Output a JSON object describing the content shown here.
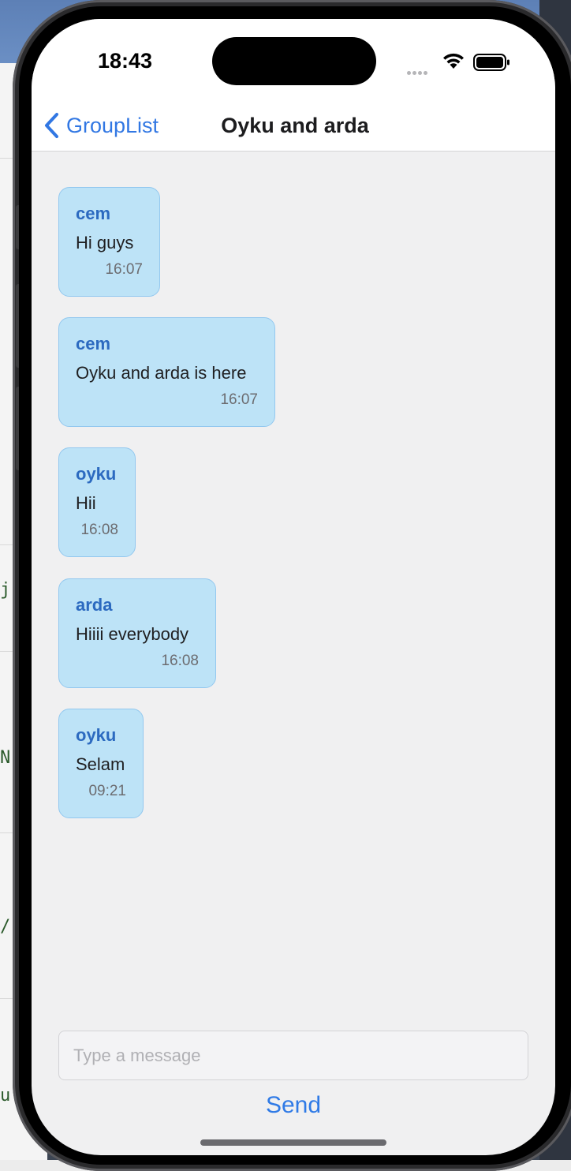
{
  "status_bar": {
    "time": "18:43",
    "icons": [
      "signal-dots-icon",
      "wifi-icon",
      "battery-icon"
    ]
  },
  "nav": {
    "back_label": "GroupList",
    "title": "Oyku and arda"
  },
  "messages": [
    {
      "sender": "cem",
      "text": "Hi guys",
      "time": "16:07"
    },
    {
      "sender": "cem",
      "text": "Oyku and arda is here",
      "time": "16:07"
    },
    {
      "sender": "oyku",
      "text": "Hii",
      "time": "16:08"
    },
    {
      "sender": "arda",
      "text": "Hiiii everybody",
      "time": "16:08"
    },
    {
      "sender": "oyku",
      "text": "Selam",
      "time": "09:21"
    }
  ],
  "composer": {
    "placeholder": "Type a message",
    "value": "",
    "send_label": "Send"
  },
  "colors": {
    "accent": "#2f7ae6",
    "bubble": "#bde3f7",
    "sender": "#2c6ac0"
  }
}
